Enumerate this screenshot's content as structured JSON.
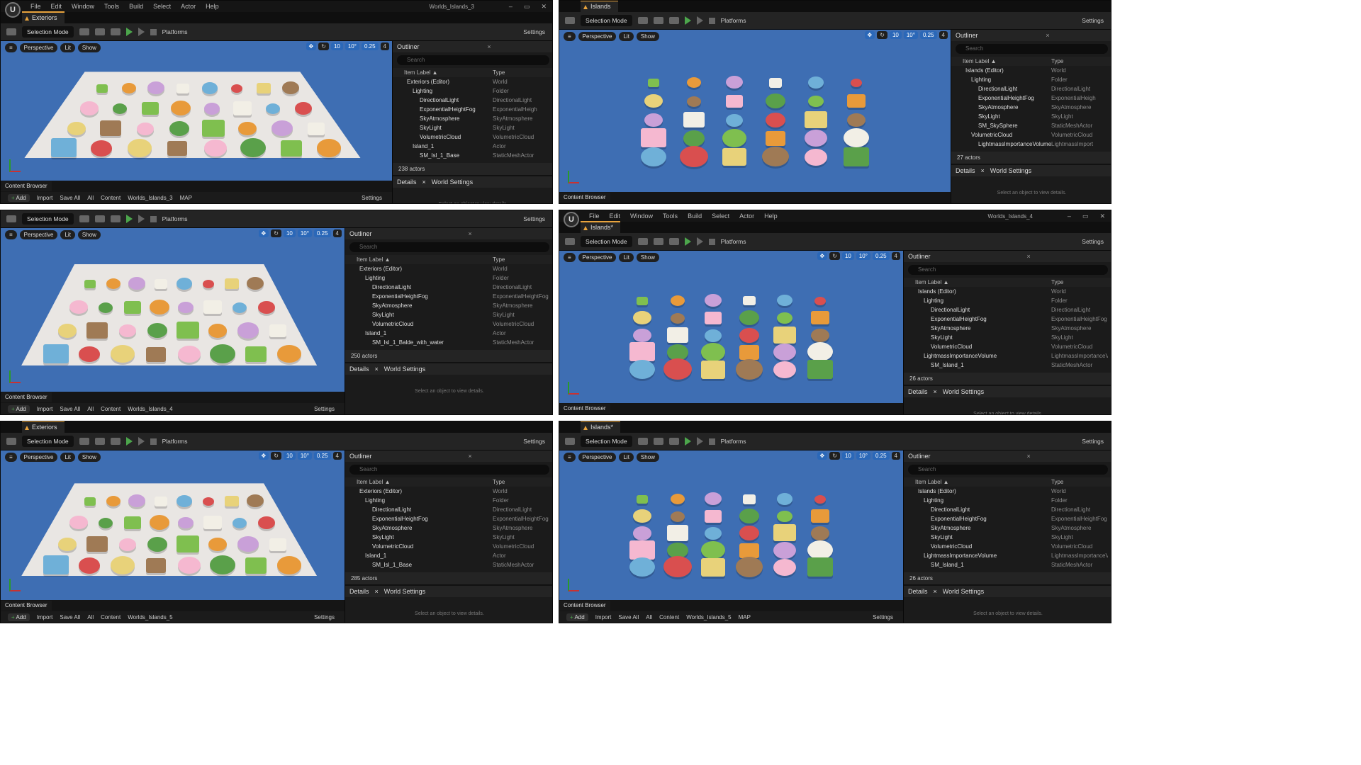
{
  "menus": [
    "File",
    "Edit",
    "Window",
    "Tools",
    "Build",
    "Select",
    "Actor",
    "Help"
  ],
  "toolbar": {
    "mode": "Selection Mode",
    "platforms": "Platforms",
    "settings": "Settings"
  },
  "viewport": {
    "perspective": "Perspective",
    "lit": "Lit",
    "show": "Show",
    "grid": "10",
    "angle": "10°",
    "scale": "0.25",
    "cam": "4"
  },
  "outliner": {
    "title": "Outliner",
    "search": "Search",
    "col_label": "Item Label ▲",
    "col_type": "Type"
  },
  "details": {
    "title": "Details",
    "world_settings": "World Settings",
    "msg": "Select an object to view details."
  },
  "content_browser": {
    "title": "Content Browser",
    "add": "Add",
    "import": "Import",
    "save_all": "Save All",
    "settings": "Settings"
  },
  "panels": [
    {
      "tab": "Exteriors",
      "window_title": "Worlds_Islands_3",
      "menubar": true,
      "rows": [
        [
          "Exteriors (Editor)",
          "World"
        ],
        [
          "Lighting",
          "Folder"
        ],
        [
          "DirectionalLight",
          "DirectionalLight"
        ],
        [
          "ExponentialHeightFog",
          "ExponentialHeigh"
        ],
        [
          "SkyAtmosphere",
          "SkyAtmosphere"
        ],
        [
          "SkyLight",
          "SkyLight"
        ],
        [
          "VolumetricCloud",
          "VolumetricCloud"
        ],
        [
          "Island_1",
          "Actor"
        ],
        [
          "SM_Isl_1_Base",
          "StaticMeshActor"
        ]
      ],
      "actors": "238 actors",
      "path": [
        "All",
        "Content",
        "Worlds_Islands_3",
        "MAP"
      ]
    },
    {
      "tab": "Islands",
      "window_title": "",
      "menubar": false,
      "rows": [
        [
          "Islands (Editor)",
          "World"
        ],
        [
          "Lighting",
          "Folder"
        ],
        [
          "DirectionalLight",
          "DirectionalLight"
        ],
        [
          "ExponentialHeightFog",
          "ExponentialHeigh"
        ],
        [
          "SkyAtmosphere",
          "SkyAtmosphere"
        ],
        [
          "SkyLight",
          "SkyLight"
        ],
        [
          "SM_SkySphere",
          "StaticMeshActor"
        ],
        [
          "VolumetricCloud",
          "VolumetricCloud"
        ],
        [
          "LightmassImportanceVolume",
          "LightmassImport"
        ]
      ],
      "actors": "27 actors",
      "path": []
    },
    {
      "tab": "",
      "window_title": "",
      "menubar": false,
      "rows": [
        [
          "Exteriors (Editor)",
          "World"
        ],
        [
          "Lighting",
          "Folder"
        ],
        [
          "DirectionalLight",
          "DirectionalLight"
        ],
        [
          "ExponentialHeightFog",
          "ExponentialHeightFog"
        ],
        [
          "SkyAtmosphere",
          "SkyAtmosphere"
        ],
        [
          "SkyLight",
          "SkyLight"
        ],
        [
          "VolumetricCloud",
          "VolumetricCloud"
        ],
        [
          "Island_1",
          "Actor"
        ],
        [
          "SM_Isl_1_Balde_with_water",
          "StaticMeshActor"
        ]
      ],
      "actors": "250 actors",
      "path": [
        "All",
        "Content",
        "Worlds_Islands_4"
      ]
    },
    {
      "tab": "Islands*",
      "window_title": "Worlds_Islands_4",
      "menubar": true,
      "rows": [
        [
          "Islands (Editor)",
          "World"
        ],
        [
          "Lighting",
          "Folder"
        ],
        [
          "DirectionalLight",
          "DirectionalLight"
        ],
        [
          "ExponentialHeightFog",
          "ExponentialHeightFog"
        ],
        [
          "SkyAtmosphere",
          "SkyAtmosphere"
        ],
        [
          "SkyLight",
          "SkyLight"
        ],
        [
          "VolumetricCloud",
          "VolumetricCloud"
        ],
        [
          "LightmassImportanceVolume",
          "LightmassImportanceV"
        ],
        [
          "SM_Island_1",
          "StaticMeshActor"
        ]
      ],
      "actors": "26 actors",
      "path": []
    },
    {
      "tab": "Exteriors",
      "window_title": "",
      "menubar": false,
      "rows": [
        [
          "Exteriors (Editor)",
          "World"
        ],
        [
          "Lighting",
          "Folder"
        ],
        [
          "DirectionalLight",
          "DirectionalLight"
        ],
        [
          "ExponentialHeightFog",
          "ExponentialHeightFog"
        ],
        [
          "SkyAtmosphere",
          "SkyAtmosphere"
        ],
        [
          "SkyLight",
          "SkyLight"
        ],
        [
          "VolumetricCloud",
          "VolumetricCloud"
        ],
        [
          "Island_1",
          "Actor"
        ],
        [
          "SM_Isl_1_Base",
          "StaticMeshActor"
        ]
      ],
      "actors": "285 actors",
      "path": [
        "All",
        "Content",
        "Worlds_Islands_5"
      ]
    },
    {
      "tab": "Islands*",
      "window_title": "",
      "menubar": false,
      "rows": [
        [
          "Islands (Editor)",
          "World"
        ],
        [
          "Lighting",
          "Folder"
        ],
        [
          "DirectionalLight",
          "DirectionalLight"
        ],
        [
          "ExponentialHeightFog",
          "ExponentialHeightFog"
        ],
        [
          "SkyAtmosphere",
          "SkyAtmosphere"
        ],
        [
          "SkyLight",
          "SkyLight"
        ],
        [
          "VolumetricCloud",
          "VolumetricCloud"
        ],
        [
          "LightmassImportanceVolume",
          "LightmassImportanceV"
        ],
        [
          "SM_Island_1",
          "StaticMeshActor"
        ]
      ],
      "actors": "26 actors",
      "path": [
        "All",
        "Content",
        "Worlds_Islands_5",
        "MAP"
      ]
    }
  ],
  "colors": {
    "accent": "#e8a33d",
    "viewport_blue": "#3e6eb3",
    "play_green": "#4ca64c",
    "panel_bg": "#1b1b1b"
  }
}
